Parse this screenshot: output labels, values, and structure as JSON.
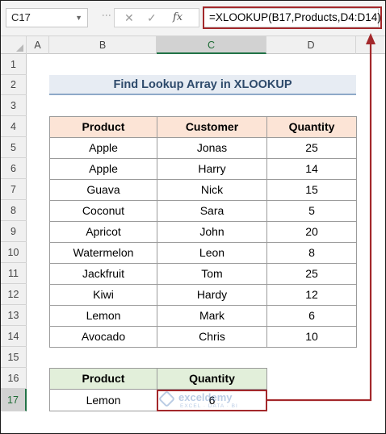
{
  "name_box": "C17",
  "formula": "=XLOOKUP(B17,Products,D4:D14)",
  "columns": [
    "A",
    "B",
    "C",
    "D"
  ],
  "rows": [
    "1",
    "2",
    "3",
    "4",
    "5",
    "6",
    "7",
    "8",
    "9",
    "10",
    "11",
    "12",
    "13",
    "14",
    "15",
    "16",
    "17"
  ],
  "title": "Find Lookup Array in XLOOKUP",
  "table": {
    "headers": [
      "Product",
      "Customer",
      "Quantity"
    ],
    "rows": [
      [
        "Apple",
        "Jonas",
        "25"
      ],
      [
        "Apple",
        "Harry",
        "14"
      ],
      [
        "Guava",
        "Nick",
        "15"
      ],
      [
        "Coconut",
        "Sara",
        "5"
      ],
      [
        "Apricot",
        "John",
        "20"
      ],
      [
        "Watermelon",
        "Leon",
        "8"
      ],
      [
        "Jackfruit",
        "Tom",
        "25"
      ],
      [
        "Kiwi",
        "Hardy",
        "12"
      ],
      [
        "Lemon",
        "Mark",
        "6"
      ],
      [
        "Avocado",
        "Chris",
        "10"
      ]
    ]
  },
  "lookup": {
    "headers": [
      "Product",
      "Quantity"
    ],
    "product": "Lemon",
    "quantity": "6"
  },
  "watermark": {
    "name": "exceldemy",
    "tagline": "EXCEL · DATA · BI"
  },
  "colors": {
    "highlight": "#a3282b",
    "header_orange": "#fce4d6",
    "header_green": "#e2efda",
    "title_band": "#e7ecf3",
    "excel_green": "#217346"
  }
}
